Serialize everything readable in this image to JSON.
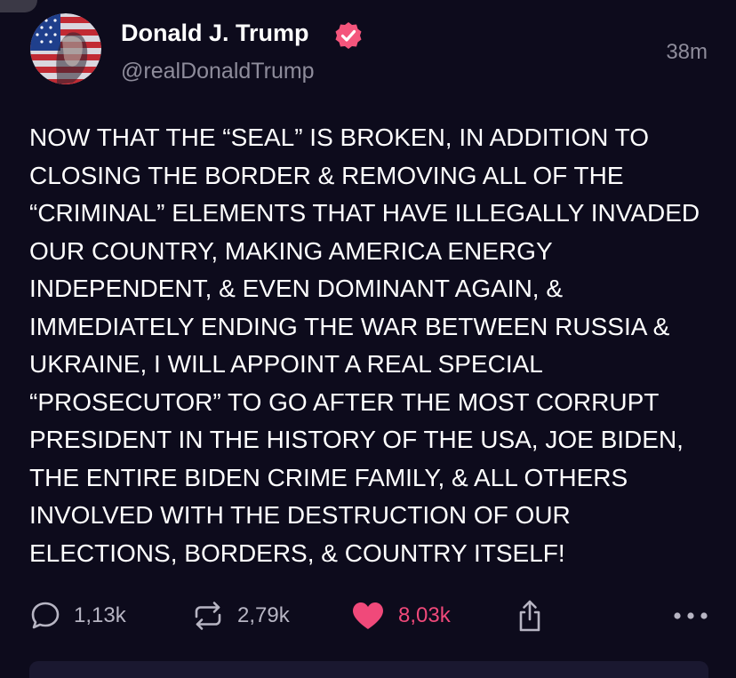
{
  "post": {
    "author_name": "Donald J. Trump",
    "handle": "@realDonaldTrump",
    "timestamp": "38m",
    "body": "NOW THAT THE “SEAL” IS BROKEN, IN ADDITION TO CLOSING THE BORDER & REMOVING ALL OF THE “CRIMINAL” ELEMENTS THAT HAVE ILLEGALLY INVADED OUR COUNTRY, MAKING AMERICA ENERGY INDEPENDENT, & EVEN DOMINANT AGAIN, & IMMEDIATELY ENDING THE WAR BETWEEN RUSSIA & UKRAINE, I WILL APPOINT A REAL SPECIAL “PROSECUTOR” TO GO AFTER THE MOST CORRUPT PRESIDENT IN THE HISTORY OF THE USA, JOE BIDEN, THE ENTIRE BIDEN CRIME FAMILY, & ALL OTHERS INVOLVED WITH THE DESTRUCTION OF OUR ELECTIONS, BORDERS, & COUNTRY ITSELF!"
  },
  "actions": {
    "replies": "1,13k",
    "retruths": "2,79k",
    "likes": "8,03k"
  },
  "icons": {
    "reply": "speech-bubble-icon",
    "retruth": "repost-arrows-icon",
    "like": "heart-icon",
    "share": "share-upload-icon",
    "more": "more-dots-icon",
    "verified": "verified-badge-icon"
  },
  "colors": {
    "background": "#0d0b1c",
    "verified_badge": "#f4557c",
    "like_active": "#f0497a",
    "muted_text": "#8e8c9b"
  }
}
